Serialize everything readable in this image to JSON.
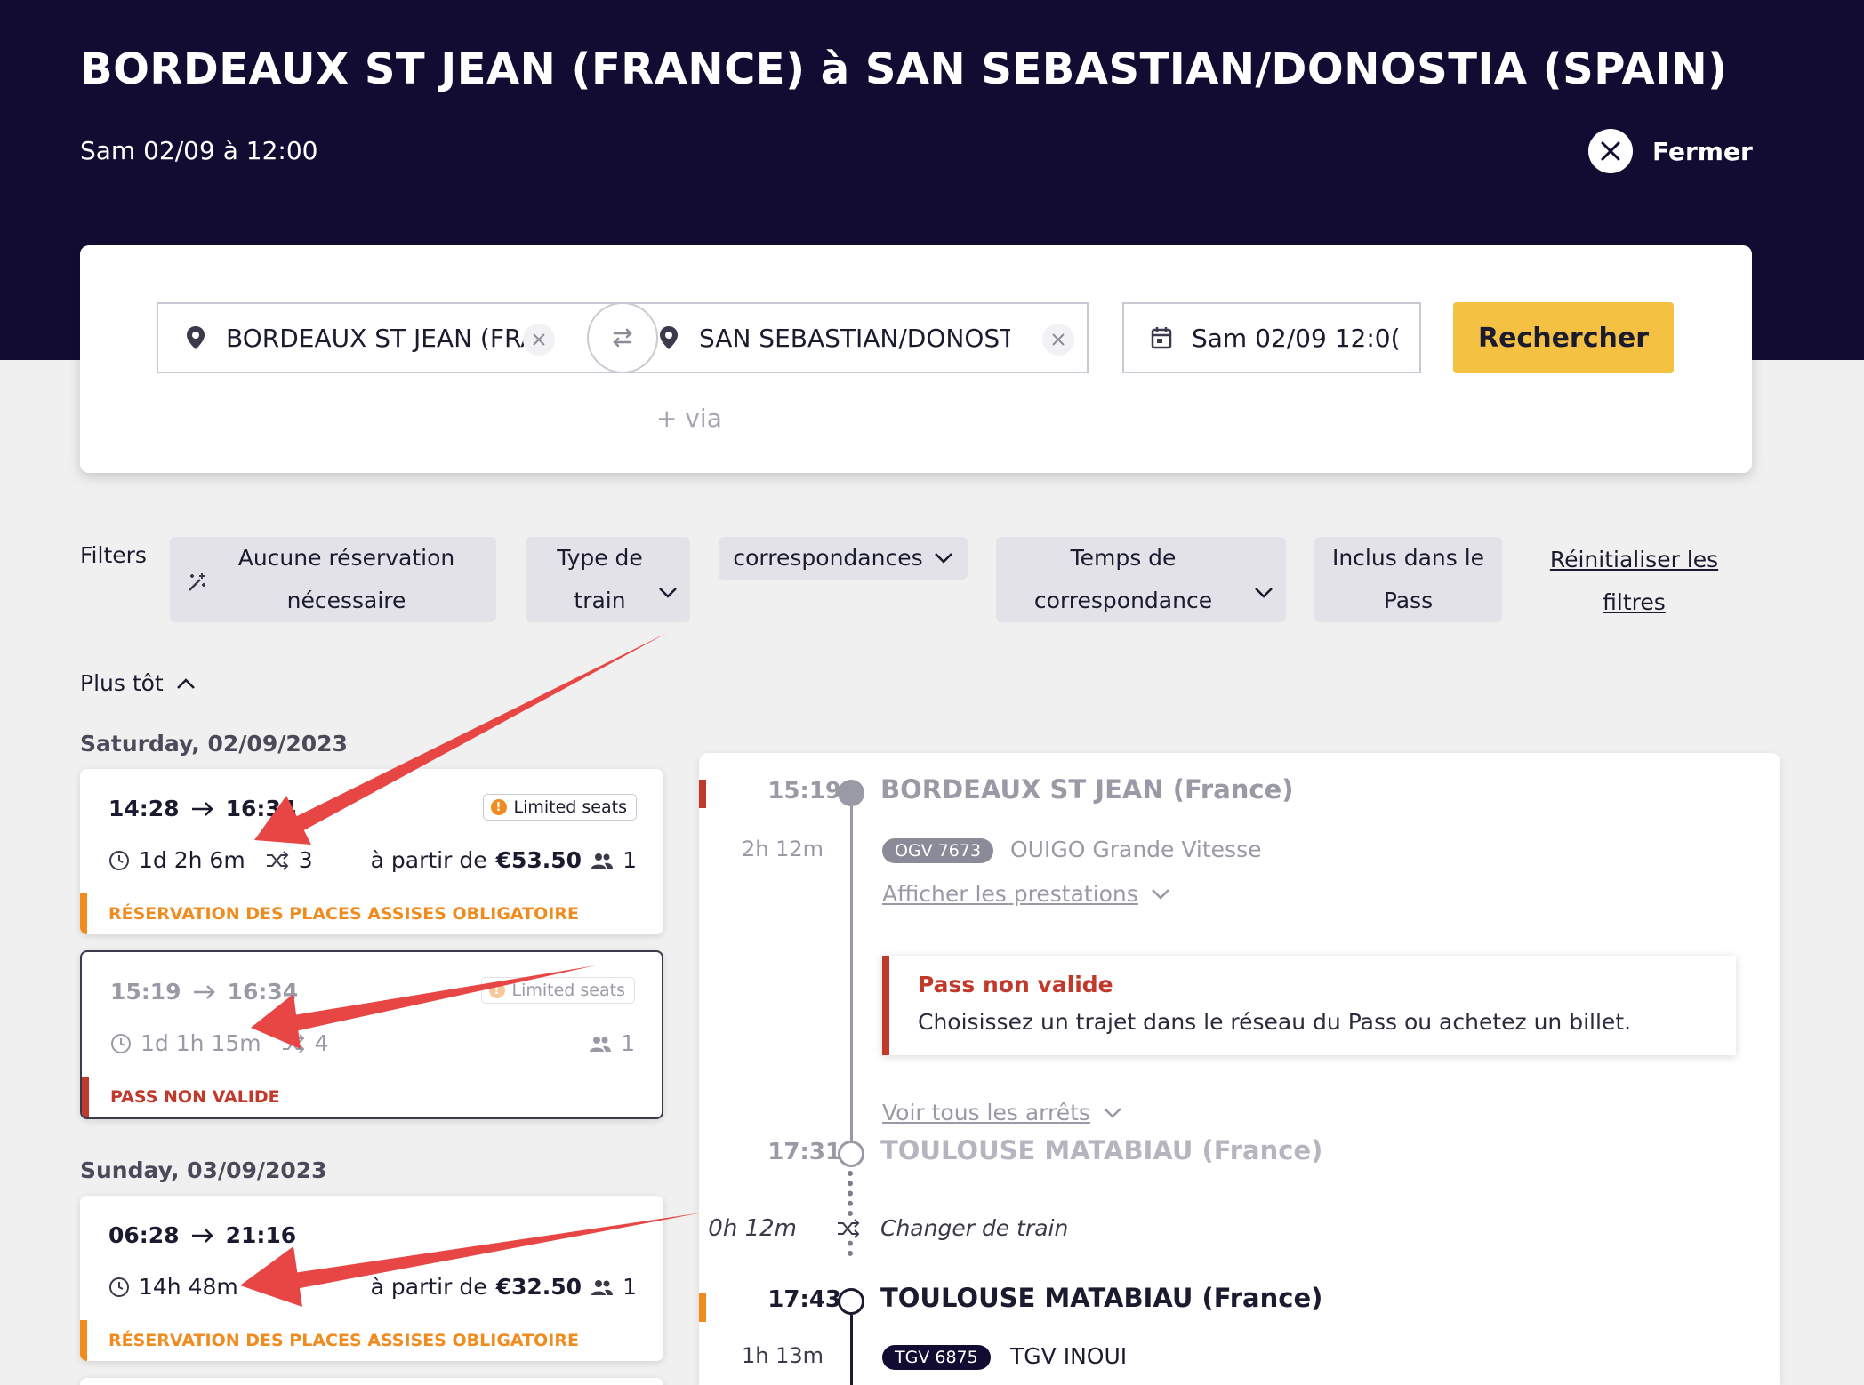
{
  "header": {
    "title": "BORDEAUX ST JEAN (FRANCE) à SAN SEBASTIAN/DONOSTIA (SPAIN)",
    "datetime": "Sam 02/09 à 12:00",
    "close_label": "Fermer"
  },
  "search": {
    "origin": "BORDEAUX ST JEAN (FRAN",
    "destination": "SAN SEBASTIAN/DONOSTI",
    "date": "Sam 02/09 12:0(",
    "search_label": "Rechercher",
    "via_label": "+ via"
  },
  "filters": {
    "label": "Filters",
    "no_reservation": [
      "Aucune réservation",
      "nécessaire"
    ],
    "train_type": [
      "Type de",
      "train"
    ],
    "connections": "correspondances",
    "connection_time": [
      "Temps de",
      "correspondance"
    ],
    "included_pass": [
      "Inclus dans le",
      "Pass"
    ],
    "reset": [
      "Réinitialiser les",
      "filtres"
    ]
  },
  "earlier_label": "Plus tôt",
  "days": [
    {
      "label": "Saturday, 02/09/2023"
    },
    {
      "label": "Sunday, 03/09/2023"
    }
  ],
  "journeys": [
    {
      "depart": "14:28",
      "arrive": "16:34",
      "badge": "Limited seats",
      "duration": "1d 2h 6m",
      "changes": "3",
      "price_prefix": "à partir de",
      "price": "€53.50",
      "pax": "1",
      "warning": "RÉSERVATION DES PLACES ASSISES OBLIGATOIRE"
    },
    {
      "depart": "15:19",
      "arrive": "16:34",
      "badge": "Limited seats",
      "duration": "1d 1h 15m",
      "changes": "4",
      "pax": "1",
      "warning": "PASS NON VALIDE"
    },
    {
      "depart": "06:28",
      "arrive": "21:16",
      "duration": "14h 48m",
      "changes": "",
      "price_prefix": "à partir de",
      "price": "€32.50",
      "pax": "1",
      "warning": "RÉSERVATION DES PLACES ASSISES OBLIGATOIRE"
    }
  ],
  "detail": {
    "stop1": {
      "time": "15:19",
      "station": "BORDEAUX ST JEAN (France)"
    },
    "leg1": {
      "duration": "2h 12m",
      "train": "OGV 7673",
      "operator": "OUIGO Grande Vitesse",
      "services_link": "Afficher les prestations"
    },
    "alert": {
      "title": "Pass non valide",
      "body": "Choisissez un trajet dans le réseau du Pass ou achetez un billet."
    },
    "all_stops_link": "Voir tous les arrêts",
    "stop2": {
      "time": "17:31",
      "station": "TOULOUSE MATABIAU (France)"
    },
    "change": {
      "duration": "0h 12m",
      "label": "Changer de train"
    },
    "stop3": {
      "time": "17:43",
      "station": "TOULOUSE MATABIAU (France)"
    },
    "leg2": {
      "duration": "1h 13m",
      "train": "TGV 6875",
      "operator": "TGV INOUI"
    }
  },
  "colors": {
    "header_bg": "#120c32",
    "accent_yellow": "#f5c143",
    "warning_orange": "#f08c1f",
    "error_red": "#c0392b",
    "annotation_arrow": "#e84545"
  }
}
